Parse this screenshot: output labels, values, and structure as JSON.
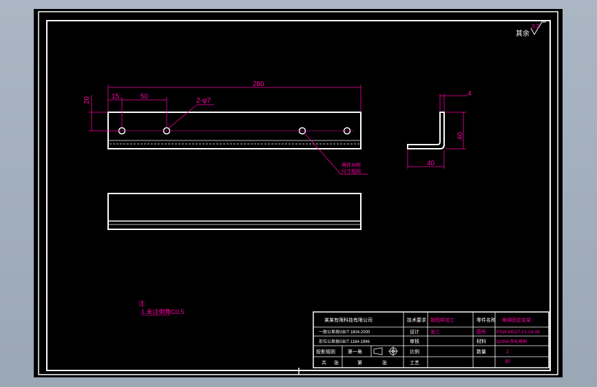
{
  "surface_finish": {
    "label": "其余",
    "value": "3.2"
  },
  "dimensions": {
    "overall_length": "280",
    "first_hole_offset": "15",
    "hole_pitch": "50",
    "hole_callout": "2-φ7",
    "hole_height": "20",
    "thickness": "4",
    "leg_height": "40",
    "leg_width": "40"
  },
  "leader_note": [
    "两件对称",
    "尺寸相同"
  ],
  "notes": {
    "title": "注:",
    "line1": "1.未注倒角C0.5"
  },
  "title_block": {
    "r1": {
      "company": "某某有限科技有限公司",
      "label1": "技术要求",
      "value1": "按图样加工",
      "label2": "零件名称",
      "value2": "角钢固定支架"
    },
    "r2": {
      "standard": "一般公差按GB/T 1804-2000",
      "label1": "设计",
      "value1": "张三",
      "label2": "图号",
      "value2": "PSW-MDZ7-01-04-08"
    },
    "r3": {
      "standard2": "形位公差按GB/T 1184-1996",
      "label1": "审核",
      "value1": "",
      "label2": "材料",
      "value2": "Q235A 热轧角钢"
    },
    "r4": {
      "view_label": "投影规则",
      "view_value": "第一角",
      "label1": "比例",
      "value1": "",
      "label2": "数量",
      "value2": "2"
    },
    "r5": {
      "sheet_label": "共",
      "sheet_mid": "张",
      "sheet_page": "第",
      "sheet_end": "张",
      "label1": "工艺",
      "value1": "",
      "label2": "",
      "value2": "30"
    }
  },
  "colors": {
    "background": "#000000",
    "outline": "#ffffff",
    "dimension": "#ff00a8",
    "title_text": "#ffffff",
    "title_value": "#ff00a8"
  }
}
